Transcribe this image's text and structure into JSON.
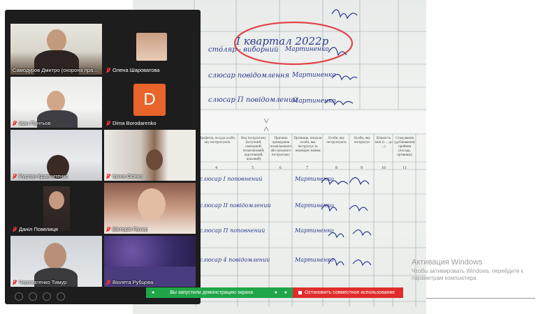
{
  "participants": [
    {
      "name": "Самодуров Дмитро (охорона пра...",
      "muted": false,
      "active": true
    },
    {
      "name": "Олена Шароватова",
      "muted": true
    },
    {
      "name": "Іван Пантьов",
      "muted": true
    },
    {
      "name": "Dima Borodarenko",
      "muted": true,
      "avatar_letter": "D",
      "avatar_color": "#e8642b"
    },
    {
      "name": "Руслан Кравчитенко",
      "muted": true
    },
    {
      "name": "Ірина Осінка",
      "muted": true
    },
    {
      "name": "Даніл Повелиця",
      "muted": true
    },
    {
      "name": "Вікторія Пухир",
      "muted": true
    },
    {
      "name": "Череватенко Тимур",
      "muted": true
    },
    {
      "name": "Віолета Рубцова",
      "muted": true
    }
  ],
  "share_bar": {
    "status": "Вы запустили демонстрацию экрана",
    "stop_label": "Остановить совместное использование",
    "green": "#21a549",
    "red": "#e02c2c"
  },
  "watermark": {
    "title": "Активация Windows",
    "text": "Чтобы активировать Windows, перейдите к параметрам компьютера."
  },
  "document": {
    "annotation": "І квартал 2022р",
    "top_rows": [
      "сто́ляр - виборний",
      "слюсар повідомлення",
      "слюсар П повідомлений"
    ],
    "bottom_rows": [
      "слюсар І поповнений",
      "слюсар ІІ повідомлений",
      "слюсар П поповнений",
      "слюсар 4 повідомлений"
    ],
    "column_headers": [
      "Професія, посада особи, яку інструктують",
      "Вид інструктажу (вступний, повторний, позаплановий, підготовчий, цільовий)",
      "Причина проведення позапланового або цільового інструктажу",
      "Прізвище, ініціали особи, яка інструктує та перевіряє знання",
      "Особи, яку інструктують",
      "Особи, яка інструктує",
      "Кількість змін (з ... до ...)",
      "Стажування (дублювання) прийняв (посада, прізвище)"
    ],
    "column_numbers": [
      "4",
      "5",
      "6",
      "7",
      "8",
      "9",
      "10",
      "11"
    ],
    "signature_name": "Мартиненко"
  }
}
